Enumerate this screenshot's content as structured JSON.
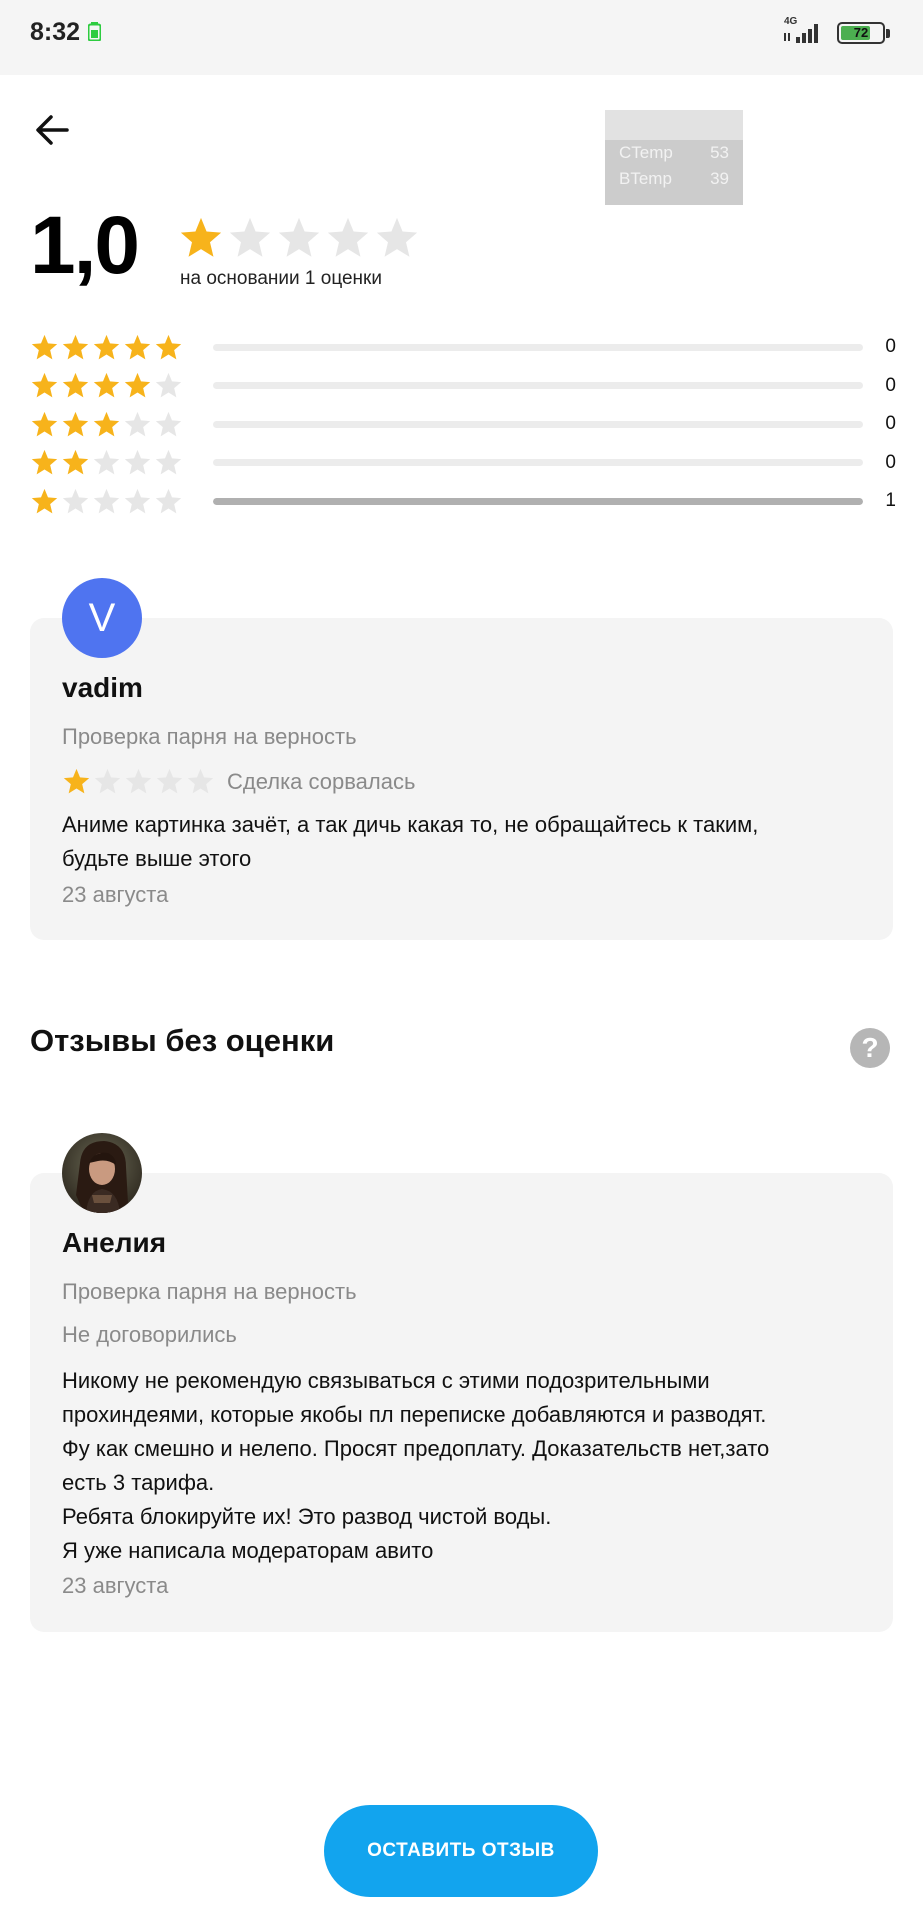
{
  "status_bar": {
    "time": "8:32",
    "network": "4G",
    "battery": "72",
    "battery_level": 0.72
  },
  "temp_overlay": {
    "rows": [
      {
        "label": "CTemp",
        "value": "53"
      },
      {
        "label": "BTemp",
        "value": "39"
      }
    ]
  },
  "summary": {
    "rating": "1,0",
    "stars_filled": 1,
    "caption": "на основании 1 оценки",
    "distribution": [
      {
        "stars": 5,
        "count": "0",
        "fraction": 0
      },
      {
        "stars": 4,
        "count": "0",
        "fraction": 0
      },
      {
        "stars": 3,
        "count": "0",
        "fraction": 0
      },
      {
        "stars": 2,
        "count": "0",
        "fraction": 0
      },
      {
        "stars": 1,
        "count": "1",
        "fraction": 1
      }
    ]
  },
  "reviews": [
    {
      "avatar_letter": "V",
      "name": "vadim",
      "service": "Проверка парня на верность",
      "stars": 1,
      "status": "Сделка сорвалась",
      "text": "Аниме картинка зачёт, а так дичь какая то, не обращайтесь к таким,\nбудьте выше этого",
      "date": "23 августа"
    }
  ],
  "unrated_section": {
    "title": "Отзывы без оценки",
    "help_icon": "?"
  },
  "unrated_reviews": [
    {
      "name": "Анелия",
      "service": "Проверка парня на верность",
      "status": "Не договорились",
      "text": "Никому не рекомендую связываться с этими подозрительными\nпрохиндеями, которые якобы пл переписке добавляются и разводят.\nФу как смешно и нелепо. Просят предоплату. Доказательств нет,зато\nесть 3 тарифа.\nРебята блокируйте их! Это развод чистой воды.\nЯ уже написала модераторам авито",
      "date": "23 августа"
    }
  ],
  "cta": {
    "label": "ОСТАВИТЬ ОТЗЫВ"
  },
  "colors": {
    "star_filled": "#f7b31b",
    "star_empty": "#e6e6e6",
    "accent": "#12a4ee",
    "avatar": "#4f74f0"
  }
}
